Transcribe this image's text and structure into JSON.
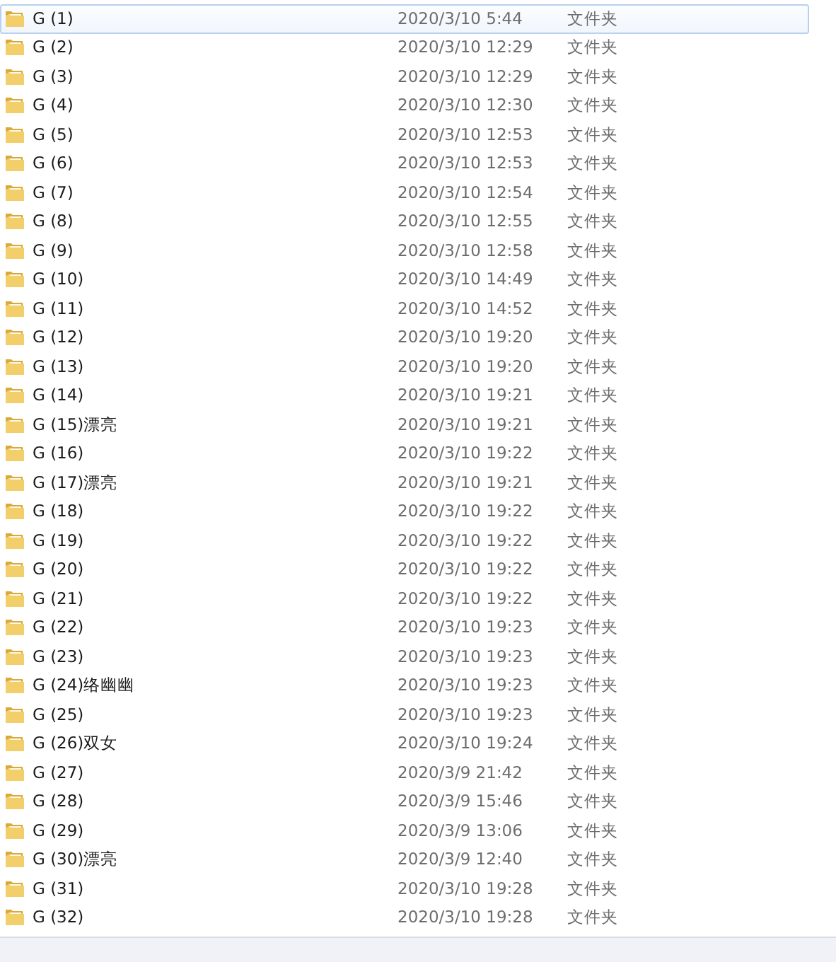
{
  "files": [
    {
      "name": "G (1)",
      "modified": "2020/3/10 5:44",
      "type": "文件夹",
      "selected": true
    },
    {
      "name": "G (2)",
      "modified": "2020/3/10 12:29",
      "type": "文件夹",
      "selected": false
    },
    {
      "name": "G (3)",
      "modified": "2020/3/10 12:29",
      "type": "文件夹",
      "selected": false
    },
    {
      "name": "G (4)",
      "modified": "2020/3/10 12:30",
      "type": "文件夹",
      "selected": false
    },
    {
      "name": "G (5)",
      "modified": "2020/3/10 12:53",
      "type": "文件夹",
      "selected": false
    },
    {
      "name": "G (6)",
      "modified": "2020/3/10 12:53",
      "type": "文件夹",
      "selected": false
    },
    {
      "name": "G (7)",
      "modified": "2020/3/10 12:54",
      "type": "文件夹",
      "selected": false
    },
    {
      "name": "G (8)",
      "modified": "2020/3/10 12:55",
      "type": "文件夹",
      "selected": false
    },
    {
      "name": "G (9)",
      "modified": "2020/3/10 12:58",
      "type": "文件夹",
      "selected": false
    },
    {
      "name": "G (10)",
      "modified": "2020/3/10 14:49",
      "type": "文件夹",
      "selected": false
    },
    {
      "name": "G (11)",
      "modified": "2020/3/10 14:52",
      "type": "文件夹",
      "selected": false
    },
    {
      "name": "G (12)",
      "modified": "2020/3/10 19:20",
      "type": "文件夹",
      "selected": false
    },
    {
      "name": "G (13)",
      "modified": "2020/3/10 19:20",
      "type": "文件夹",
      "selected": false
    },
    {
      "name": "G (14)",
      "modified": "2020/3/10 19:21",
      "type": "文件夹",
      "selected": false
    },
    {
      "name": "G (15)漂亮",
      "modified": "2020/3/10 19:21",
      "type": "文件夹",
      "selected": false
    },
    {
      "name": "G (16)",
      "modified": "2020/3/10 19:22",
      "type": "文件夹",
      "selected": false
    },
    {
      "name": "G (17)漂亮",
      "modified": "2020/3/10 19:21",
      "type": "文件夹",
      "selected": false
    },
    {
      "name": "G (18)",
      "modified": "2020/3/10 19:22",
      "type": "文件夹",
      "selected": false
    },
    {
      "name": "G (19)",
      "modified": "2020/3/10 19:22",
      "type": "文件夹",
      "selected": false
    },
    {
      "name": "G (20)",
      "modified": "2020/3/10 19:22",
      "type": "文件夹",
      "selected": false
    },
    {
      "name": "G (21)",
      "modified": "2020/3/10 19:22",
      "type": "文件夹",
      "selected": false
    },
    {
      "name": "G (22)",
      "modified": "2020/3/10 19:23",
      "type": "文件夹",
      "selected": false
    },
    {
      "name": "G (23)",
      "modified": "2020/3/10 19:23",
      "type": "文件夹",
      "selected": false
    },
    {
      "name": "G (24)络幽幽",
      "modified": "2020/3/10 19:23",
      "type": "文件夹",
      "selected": false
    },
    {
      "name": "G (25)",
      "modified": "2020/3/10 19:23",
      "type": "文件夹",
      "selected": false
    },
    {
      "name": "G (26)双女",
      "modified": "2020/3/10 19:24",
      "type": "文件夹",
      "selected": false
    },
    {
      "name": "G (27)",
      "modified": "2020/3/9 21:42",
      "type": "文件夹",
      "selected": false
    },
    {
      "name": "G (28)",
      "modified": "2020/3/9 15:46",
      "type": "文件夹",
      "selected": false
    },
    {
      "name": "G (29)",
      "modified": "2020/3/9 13:06",
      "type": "文件夹",
      "selected": false
    },
    {
      "name": "G (30)漂亮",
      "modified": "2020/3/9 12:40",
      "type": "文件夹",
      "selected": false
    },
    {
      "name": "G (31)",
      "modified": "2020/3/10 19:28",
      "type": "文件夹",
      "selected": false
    },
    {
      "name": "G (32)",
      "modified": "2020/3/10 19:28",
      "type": "文件夹",
      "selected": false
    }
  ]
}
